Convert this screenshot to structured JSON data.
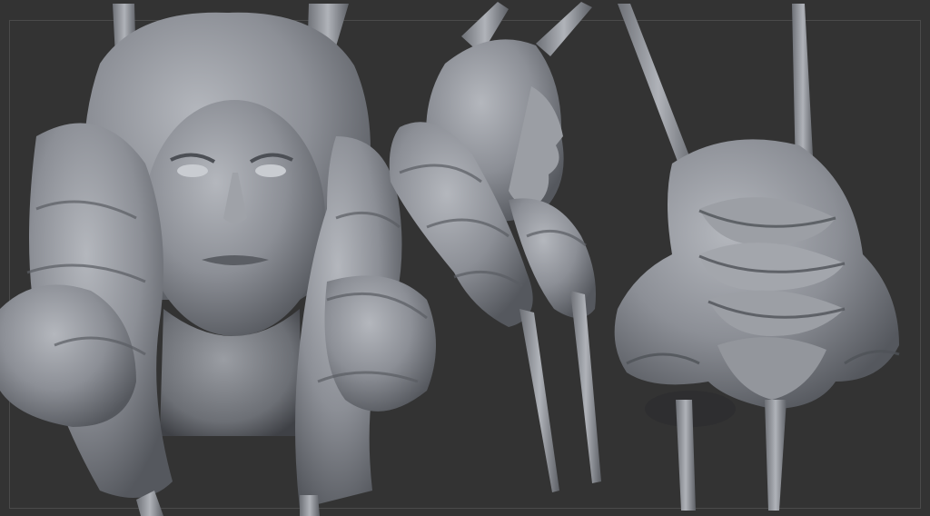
{
  "scene": {
    "background_color": "#333333",
    "frame_color": "#4a4a4a",
    "clay_color": "#8c8f96",
    "clay_shadow_color": "#55585e",
    "clay_highlight_color": "#b4b7bd",
    "views": [
      "front-view",
      "side-view",
      "back-view"
    ]
  }
}
